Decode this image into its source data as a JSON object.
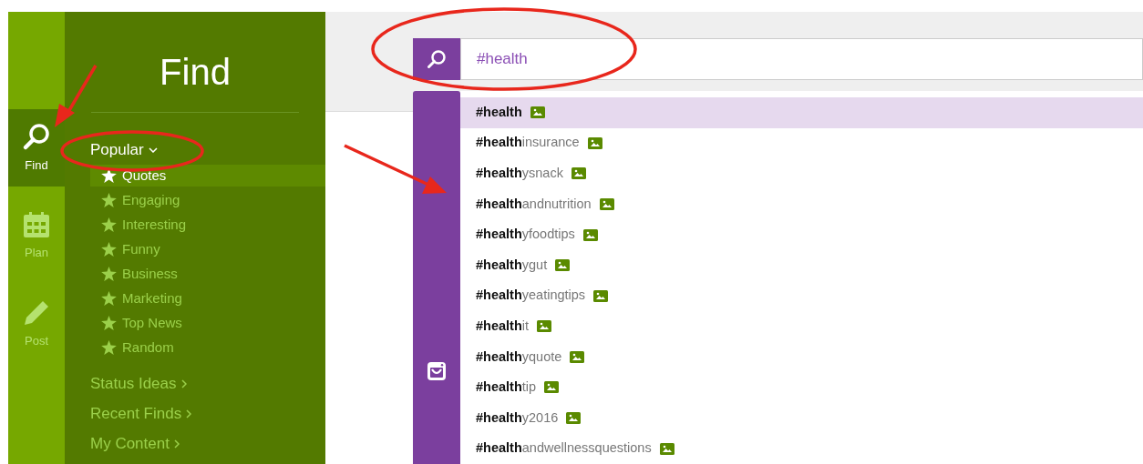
{
  "rail": {
    "items": [
      {
        "kind": "find",
        "label": "Find",
        "selected": true
      },
      {
        "kind": "plan",
        "label": "Plan",
        "selected": false
      },
      {
        "kind": "post",
        "label": "Post",
        "selected": false
      }
    ]
  },
  "panel": {
    "title": "Find",
    "sections": [
      {
        "label": "Popular",
        "expanded": true,
        "items": [
          {
            "label": "Quotes",
            "selected": true
          },
          {
            "label": "Engaging",
            "selected": false
          },
          {
            "label": "Interesting",
            "selected": false
          },
          {
            "label": "Funny",
            "selected": false
          },
          {
            "label": "Business",
            "selected": false
          },
          {
            "label": "Marketing",
            "selected": false
          },
          {
            "label": "Top News",
            "selected": false
          },
          {
            "label": "Random",
            "selected": false
          }
        ]
      },
      {
        "label": "Status Ideas",
        "expanded": false
      },
      {
        "label": "Recent Finds",
        "expanded": false
      },
      {
        "label": "My Content",
        "expanded": false
      }
    ]
  },
  "search": {
    "value": "#health"
  },
  "suggestions": [
    {
      "text": "**#health**",
      "selected": true
    },
    {
      "text": "**#health**insurance",
      "selected": false
    },
    {
      "text": "**#health**ysnack",
      "selected": false
    },
    {
      "text": "**#health**andnutrition",
      "selected": false
    },
    {
      "text": "**#health**yfoodtips",
      "selected": false
    },
    {
      "text": "**#health**ygut",
      "selected": false
    },
    {
      "text": "**#health**yeatingtips",
      "selected": false
    },
    {
      "text": "**#health**it",
      "selected": false
    },
    {
      "text": "**#health**yquote",
      "selected": false
    },
    {
      "text": "**#health**tip",
      "selected": false
    },
    {
      "text": "**#health**y2016",
      "selected": false
    },
    {
      "text": "**#health**andwellnessquestions",
      "selected": false
    }
  ]
}
